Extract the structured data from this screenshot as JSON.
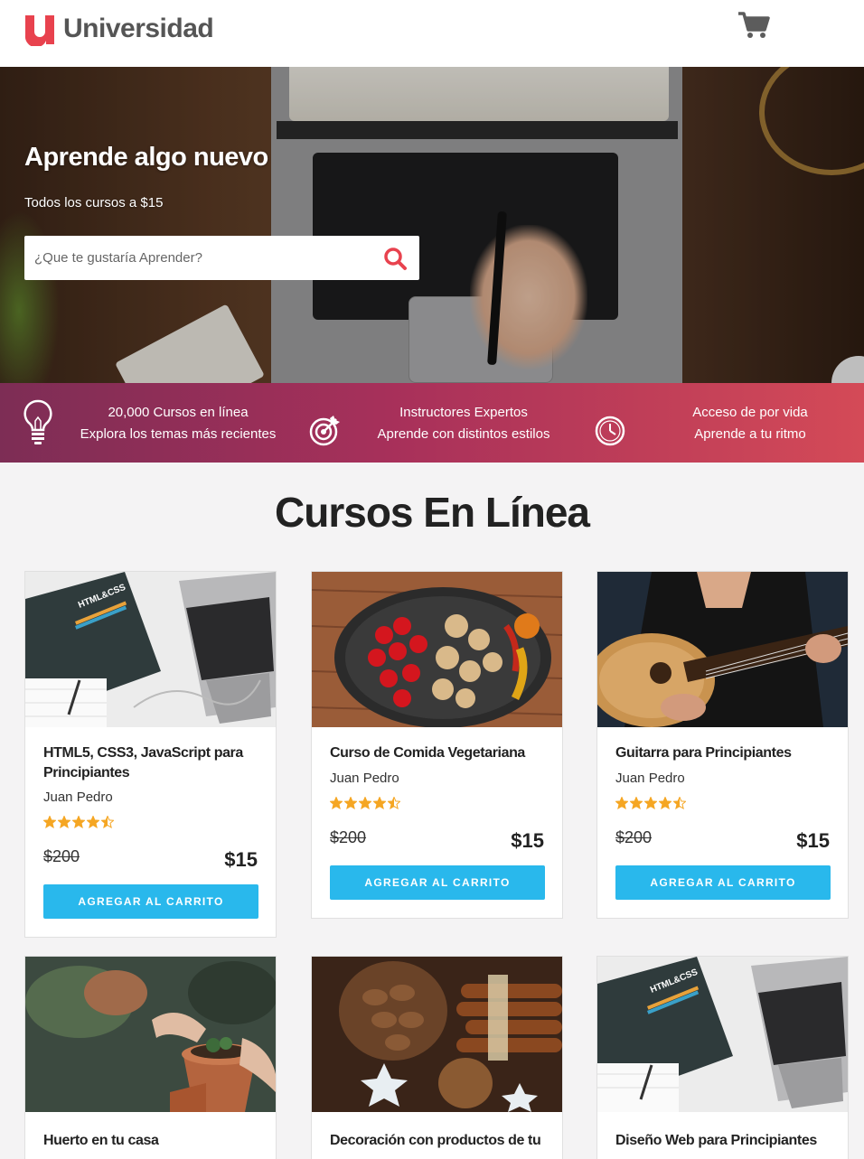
{
  "header": {
    "logo_text": "Universidad",
    "logo_letter": "u",
    "cart_icon": "shopping-cart-icon"
  },
  "hero": {
    "title": "Aprende algo nuevo",
    "subtitle": "Todos los cursos a $15",
    "search_placeholder": "¿Que te gustaría Aprender?",
    "search_icon": "search-icon"
  },
  "features": [
    {
      "icon": "lightbulb-icon",
      "line1": "20,000 Cursos en línea",
      "line2": "Explora los temas más recientes"
    },
    {
      "icon": "target-icon",
      "line1": "Instructores Expertos",
      "line2": "Aprende con distintos estilos"
    },
    {
      "icon": "clock-icon",
      "line1": "Acceso de por vida",
      "line2": "Aprende a tu ritmo"
    }
  ],
  "section": {
    "title": "Cursos En Línea"
  },
  "courses": [
    {
      "title": "HTML5, CSS3, JavaScript para Principiantes",
      "author": "Juan Pedro",
      "rating": 4.5,
      "old_price": "$200",
      "price": "$15",
      "button": "AGREGAR AL CARRITO",
      "image_label": "HTML&CSS"
    },
    {
      "title": "Curso de Comida Vegetariana",
      "author": "Juan Pedro",
      "rating": 4.5,
      "old_price": "$200",
      "price": "$15",
      "button": "AGREGAR AL CARRITO"
    },
    {
      "title": "Guitarra para Principiantes",
      "author": "Juan Pedro",
      "rating": 4.5,
      "old_price": "$200",
      "price": "$15",
      "button": "AGREGAR AL CARRITO"
    },
    {
      "title": "Huerto en tu casa"
    },
    {
      "title": "Decoración con productos de tu"
    },
    {
      "title": "Diseño Web para Principiantes",
      "image_label": "HTML&CSS"
    }
  ],
  "colors": {
    "brand_red": "#e8424e",
    "button_blue": "#29b8ec",
    "star_gold": "#f5a623",
    "features_start": "#7d2d55",
    "features_end": "#d44a57"
  }
}
